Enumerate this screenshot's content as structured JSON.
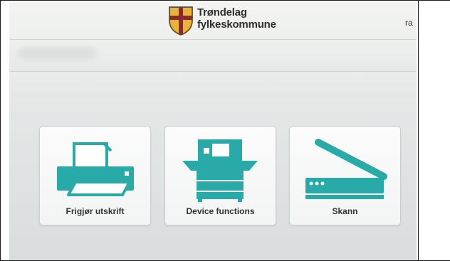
{
  "header": {
    "brand_line1": "Trøndelag",
    "brand_line2": "fylkeskommune",
    "user": "ra"
  },
  "tiles": [
    {
      "label": "Frigjør utskrift",
      "icon": "printer-icon"
    },
    {
      "label": "Device functions",
      "icon": "copier-icon"
    },
    {
      "label": "Skann",
      "icon": "scanner-icon"
    }
  ],
  "colors": {
    "accent": "#29aaa8",
    "background": "#e1e5e5",
    "tile": "#f7f8f8",
    "text": "#333333"
  }
}
